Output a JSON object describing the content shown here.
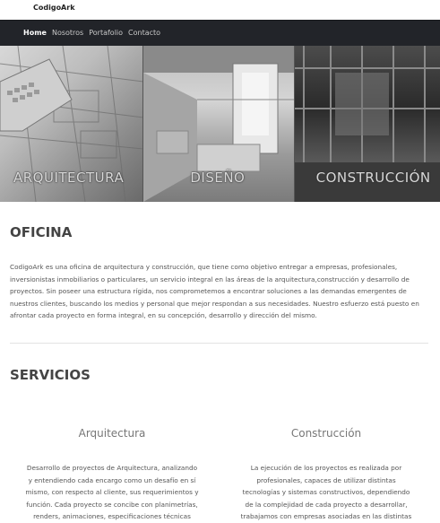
{
  "brand": "CodigoArk",
  "nav": {
    "items": [
      "Home",
      "Nosotros",
      "Portafolio",
      "Contacto"
    ]
  },
  "hero": {
    "panels": [
      "ARQUITECTURA",
      "DISEÑO",
      "CONSTRUCCIÓN"
    ]
  },
  "oficina": {
    "title": "OFICINA",
    "text": "CodigoArk es una oficina de arquitectura y construcción, que tiene como objetivo entregar a empresas, profesionales, inversionistas inmobiliarios o particulares, un servicio integral en las áreas de la arquitectura,construcción y desarrollo de proyectos. Sin poseer una estructura rígida, nos comprometemos a encontrar soluciones a las demandas emergentes de nuestros clientes, buscando los medios y personal que mejor respondan a sus necesidades. Nuestro esfuerzo está puesto en afrontar cada proyecto en forma integral, en su concepción, desarrollo y dirección del mismo."
  },
  "servicios": {
    "title": "SERVICIOS",
    "items": [
      {
        "title": "Arquitectura",
        "text": "Desarrollo de proyectos de Arquitectura, analizando y entendiendo cada encargo como un desafío en sí mismo, con respecto al cliente, sus requerimientos y función. Cada proyecto se concibe con planimetrías, renders, animaciones, especificaciones técnicas"
      },
      {
        "title": "Construcción",
        "text": "La ejecución de los proyectos es realizada por profesionales, capaces de utilizar distintas tecnologías y sistemas constructivos, dependiendo de la complejidad de cada proyecto a desarrollar, trabajamos con empresas asociadas en las distintas"
      }
    ]
  }
}
